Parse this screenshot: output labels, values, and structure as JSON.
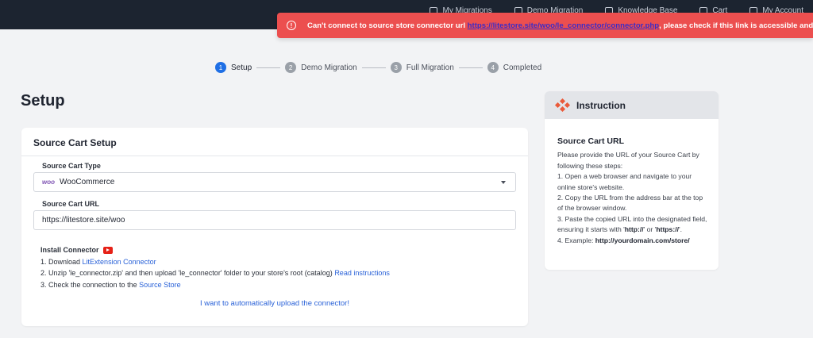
{
  "topbar": {
    "items": [
      "My Migrations",
      "Demo Migration",
      "Knowledge Base",
      "Cart",
      "My Account"
    ]
  },
  "error": {
    "prefix": "Can't connect to source store connector url ",
    "url": "https://litestore.site/woo/le_connector/connector.php",
    "suffix": ", please check if this link is accessible and try again."
  },
  "stepper": {
    "steps": [
      {
        "num": "1",
        "label": "Setup"
      },
      {
        "num": "2",
        "label": "Demo Migration"
      },
      {
        "num": "3",
        "label": "Full Migration"
      },
      {
        "num": "4",
        "label": "Completed"
      }
    ]
  },
  "page": {
    "title": "Setup"
  },
  "source_setup": {
    "title": "Source Cart Setup",
    "cart_type_label": "Source Cart Type",
    "cart_type_value": "WooCommerce",
    "cart_type_logo": "woo",
    "cart_url_label": "Source Cart URL",
    "cart_url_value": "https://litestore.site/woo",
    "install": {
      "title": "Install Connector",
      "step1_prefix": "1. Download ",
      "step1_link": "LitExtension Connector",
      "step2_prefix": "2. Unzip 'le_connector.zip' and then upload 'le_connector' folder to your store's root (catalog) ",
      "step2_link": "Read instructions",
      "step3_prefix": "3. Check the connection to the ",
      "step3_link": "Source Store"
    },
    "auto_upload_link": "I want to automatically upload the connector!"
  },
  "instruction": {
    "title": "Instruction",
    "subtitle": "Source Cart URL",
    "intro": "Please provide the URL of your Source Cart by following these steps:",
    "step1": "1. Open a web browser and navigate to your online store's website.",
    "step2": "2. Copy the URL from the address bar at the top of the browser window.",
    "step3_prefix": "3. Paste the copied URL into the designated field, ensuring it starts with '",
    "step3_http": "http://",
    "step3_mid": "' or '",
    "step3_https": "https://",
    "step3_suffix": "'.",
    "step4_prefix": "4. Example: ",
    "step4_example": "http://yourdomain.com/store/"
  },
  "colors": {
    "error_bg": "#ec4f4f",
    "topbar_bg": "#1c2430",
    "accent": "#1f6fe5",
    "link": "#2a62d8",
    "instruction_logo": "#ea5a3a"
  }
}
